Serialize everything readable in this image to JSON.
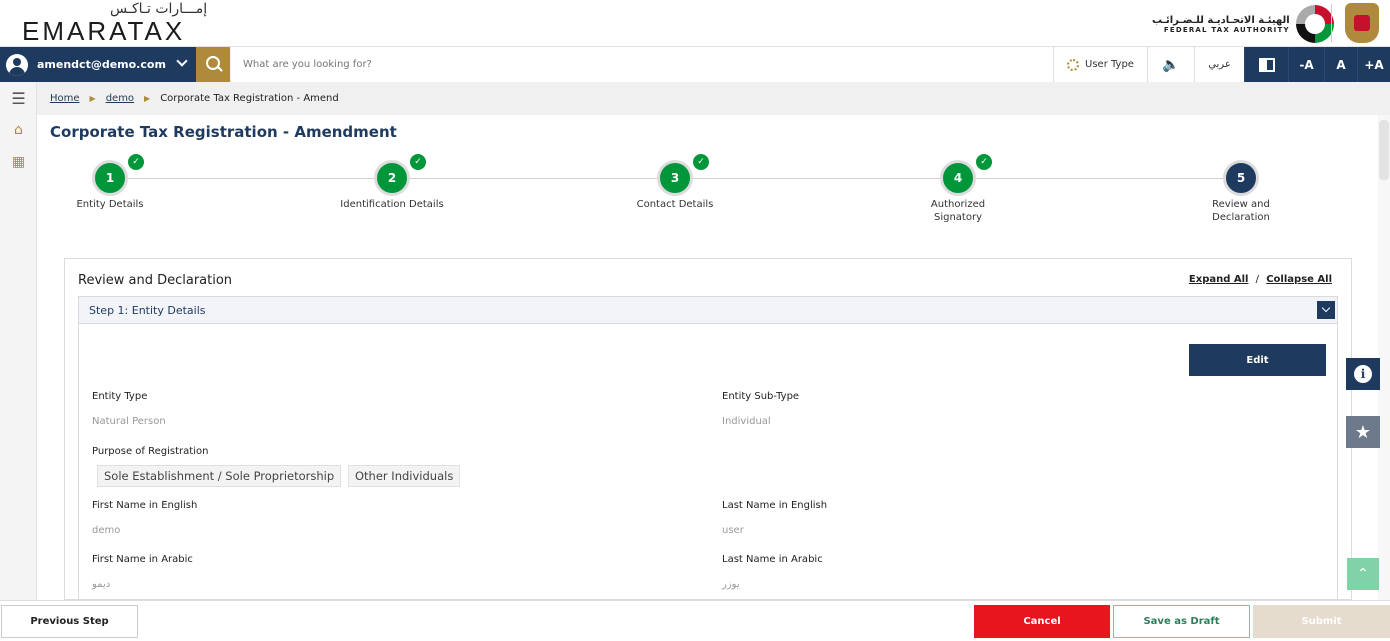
{
  "header": {
    "logo_ar": "إمـــارات تـاكـس",
    "logo_en": "EMARATAX",
    "fta_ar": "الهيئـة الاتحـاديـة للـضـرائـب",
    "fta_en": "FEDERAL TAX AUTHORITY"
  },
  "navbar": {
    "user_email": "amendct@demo.com",
    "search_placeholder": "What are you looking for?",
    "user_type": "User Type",
    "speaker": "🔈",
    "arabic": "عربي",
    "font_decrease": "-A",
    "font_normal": "A",
    "font_increase": "+A"
  },
  "sidebar": {
    "menu_icon": "☰",
    "home_icon": "⌂",
    "apps_icon": "▦"
  },
  "breadcrumb": {
    "home": "Home",
    "sep": "▶",
    "demo": "demo",
    "current": "Corporate Tax Registration - Amend"
  },
  "page": {
    "title": "Corporate Tax Registration - Amendment"
  },
  "steps": [
    {
      "number": "1",
      "label": "Entity Details",
      "completed": true
    },
    {
      "number": "2",
      "label": "Identification Details",
      "completed": true
    },
    {
      "number": "3",
      "label": "Contact Details",
      "completed": true
    },
    {
      "number": "4",
      "label": "Authorized\nSignatory",
      "completed": true
    },
    {
      "number": "5",
      "label": "Review and\nDeclaration",
      "completed": false
    }
  ],
  "check_glyph": "✓",
  "review": {
    "title": "Review and Declaration",
    "expand_all": "Expand All",
    "separator": "/",
    "collapse_all": "Collapse All",
    "section_title": "Step 1: Entity Details",
    "edit_label": "Edit",
    "fields": {
      "entity_type_label": "Entity Type",
      "entity_type_value": "Natural Person",
      "entity_subtype_label": "Entity Sub-Type",
      "entity_subtype_value": "Individual",
      "purpose_label": "Purpose of Registration",
      "purpose_chips": [
        "Sole Establishment / Sole Proprietorship",
        "Other Individuals"
      ],
      "first_name_en_label": "First Name in English",
      "first_name_en_value": "demo",
      "last_name_en_label": "Last Name in English",
      "last_name_en_value": "user",
      "first_name_ar_label": "First Name in Arabic",
      "first_name_ar_value": "ديمو",
      "last_name_ar_label": "Last Name in Arabic",
      "last_name_ar_value": "يوزر"
    }
  },
  "floating": {
    "info": "i",
    "favorite": "★",
    "scroll_top": "⌃"
  },
  "footer": {
    "previous": "Previous Step",
    "cancel": "Cancel",
    "save_draft": "Save as Draft",
    "submit": "Submit"
  },
  "colors": {
    "primary": "#1e3a5f",
    "accent": "#b08a3c",
    "success": "#009639",
    "danger": "#e8141e"
  }
}
